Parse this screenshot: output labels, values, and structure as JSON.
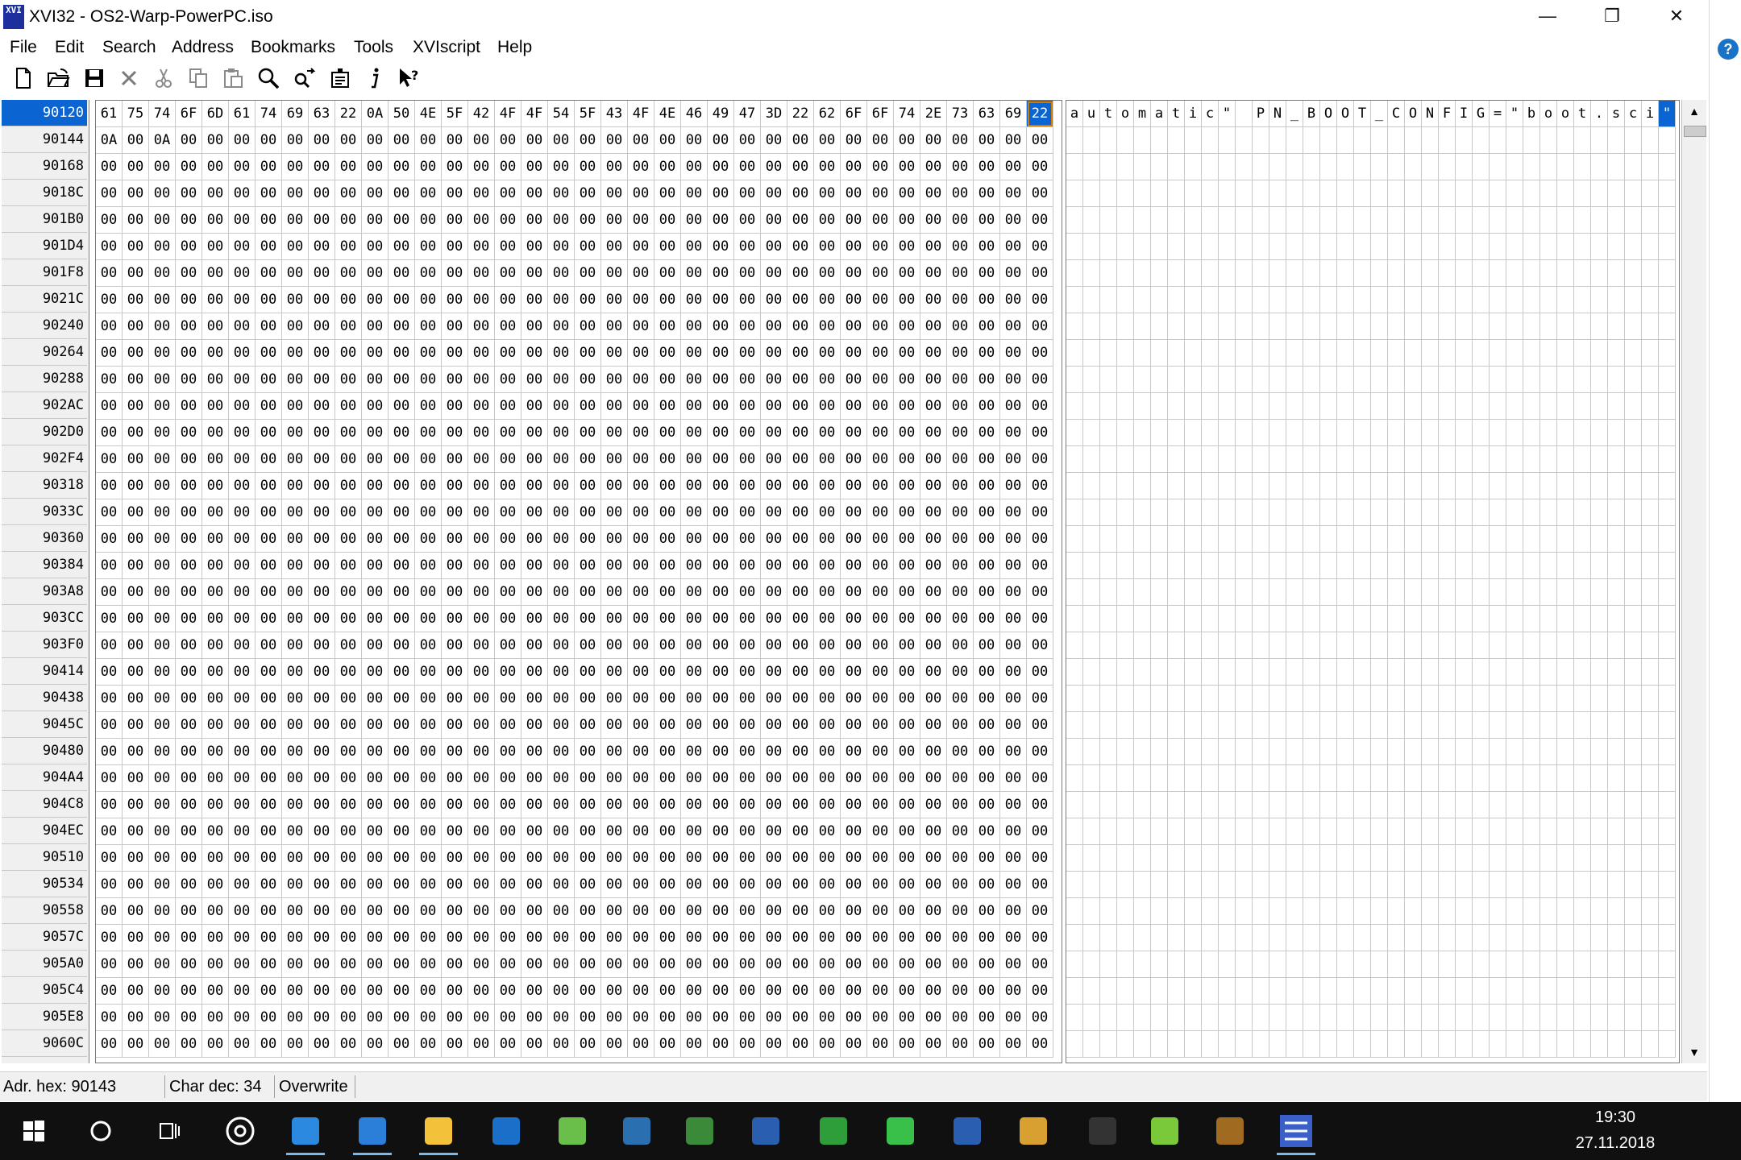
{
  "window": {
    "title": "XVI32 - OS2-Warp-PowerPC.iso",
    "app_icon_text": "XVI",
    "controls": {
      "minimize": "—",
      "restore": "❐",
      "close": "✕"
    }
  },
  "menu": [
    "File",
    "Edit",
    "Search",
    "Address",
    "Bookmarks",
    "Tools",
    "XVIscript",
    "Help"
  ],
  "toolbar": [
    {
      "icon": "new-file-icon"
    },
    {
      "icon": "open-folder-icon"
    },
    {
      "icon": "save-icon"
    },
    {
      "icon": "delete-icon"
    },
    {
      "icon": "cut-icon"
    },
    {
      "icon": "copy-icon"
    },
    {
      "icon": "paste-icon"
    },
    {
      "icon": "find-icon"
    },
    {
      "icon": "replace-icon"
    },
    {
      "icon": "properties-icon"
    },
    {
      "icon": "info-icon"
    },
    {
      "icon": "context-help-icon"
    }
  ],
  "editor": {
    "addresses": [
      "90120",
      "90144",
      "90168",
      "9018C",
      "901B0",
      "901D4",
      "901F8",
      "9021C",
      "90240",
      "90264",
      "90288",
      "902AC",
      "902D0",
      "902F4",
      "90318",
      "9033C",
      "90360",
      "90384",
      "903A8",
      "903CC",
      "903F0",
      "90414",
      "90438",
      "9045C",
      "90480",
      "904A4",
      "904C8",
      "904EC",
      "90510",
      "90534",
      "90558",
      "9057C",
      "905A0",
      "905C4",
      "905E8",
      "9060C"
    ],
    "active_address": "90120",
    "row0_hex": [
      "61",
      "75",
      "74",
      "6F",
      "6D",
      "61",
      "74",
      "69",
      "63",
      "22",
      "0A",
      "50",
      "4E",
      "5F",
      "42",
      "4F",
      "4F",
      "54",
      "5F",
      "43",
      "4F",
      "4E",
      "46",
      "49",
      "47",
      "3D",
      "22",
      "62",
      "6F",
      "6F",
      "74",
      "2E",
      "73",
      "63",
      "69",
      "22"
    ],
    "row1_hex": [
      "0A",
      "00",
      "0A",
      "00",
      "00",
      "00",
      "00",
      "00",
      "00",
      "00",
      "00",
      "00",
      "00",
      "00",
      "00",
      "00",
      "00",
      "00",
      "00",
      "00",
      "00",
      "00",
      "00",
      "00",
      "00",
      "00",
      "00",
      "00",
      "00",
      "00",
      "00",
      "00",
      "00",
      "00",
      "00",
      "00"
    ],
    "fill_byte": "00",
    "row0_text": [
      "a",
      "u",
      "t",
      "o",
      "m",
      "a",
      "t",
      "i",
      "c",
      "\"",
      "",
      "P",
      "N",
      "_",
      "B",
      "O",
      "O",
      "T",
      "_",
      "C",
      "O",
      "N",
      "F",
      "I",
      "G",
      "=",
      "\"",
      "b",
      "o",
      "o",
      "t",
      ".",
      "s",
      "c",
      "i",
      "\""
    ],
    "cursor_index": 35
  },
  "status": {
    "address": "Adr. hex: 90143",
    "char": "Char dec: 34",
    "mode": "Overwrite"
  },
  "side": {
    "help": "?"
  },
  "taskbar": {
    "apps": [
      {
        "icon": "start-icon"
      },
      {
        "icon": "cortana-icon"
      },
      {
        "icon": "task-view-icon"
      },
      {
        "icon": "media-icon"
      },
      {
        "icon": "ie-icon"
      },
      {
        "icon": "edge-icon"
      },
      {
        "icon": "explorer-icon"
      },
      {
        "icon": "outlook-icon"
      },
      {
        "icon": "app-green-icon"
      },
      {
        "icon": "app-blue-icon"
      },
      {
        "icon": "app-a-icon"
      },
      {
        "icon": "app-book-icon"
      },
      {
        "icon": "globe-icon"
      },
      {
        "icon": "sync-icon"
      },
      {
        "icon": "app-star-icon"
      },
      {
        "icon": "paint-icon"
      },
      {
        "icon": "app-dark-icon"
      },
      {
        "icon": "app-s-icon"
      },
      {
        "icon": "dosbox-icon"
      },
      {
        "icon": "hex-app-icon"
      }
    ],
    "time": "19:30",
    "date": "27.11.2018"
  }
}
